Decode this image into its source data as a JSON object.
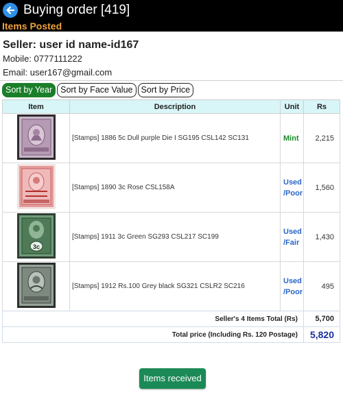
{
  "header": {
    "title": "Buying order [419]",
    "status": "Items Posted"
  },
  "seller": {
    "name": "Seller: user id name-id167",
    "mobile": "Mobile: 0777111222",
    "email": "Email: user167@gmail.com"
  },
  "sort": {
    "by_year": "Sort by Year",
    "by_face_value": "Sort by Face Value",
    "by_price": "Sort by Price",
    "active": "by_year"
  },
  "table": {
    "columns": [
      "Item",
      "Description",
      "Unit",
      "Rs"
    ],
    "rows": [
      {
        "image": "stamp-1886-dull-purple",
        "description": "[Stamps] 1886 5c Dull purple Die I SG195 CSL142 SC131",
        "unit": "Mint",
        "price": "2,215"
      },
      {
        "image": "stamp-1890-rose-overprint",
        "description": "[Stamps] 1890 3c Rose CSL158A",
        "unit": "Used /Poor",
        "price": "1,560"
      },
      {
        "image": "stamp-1911-green",
        "description": "[Stamps] 1911 3c Green SG293 CSL217 SC199",
        "unit": "Used /Fair",
        "price": "1,430"
      },
      {
        "image": "stamp-1912-grey-black",
        "description": "[Stamps] 1912 Rs.100 Grey black SG321 CSLR2 SC216",
        "unit": "Used /Poor",
        "price": "495"
      }
    ]
  },
  "totals": {
    "items_label": "Seller's 4 Items Total (Rs)",
    "items_value": "5,700",
    "total_label": "Total price (Including Rs. 120 Postage)",
    "total_value": "5,820"
  },
  "actions": {
    "received": "Items received"
  },
  "colors": {
    "header_bg": "#000000",
    "status": "#f0a23c",
    "sort_active": "#1b7f2a",
    "table_header": "#d8f5f7",
    "mint": "#1b8a2a",
    "used": "#2a66c8",
    "total_value": "#1a2fa0",
    "received_button": "#1b8a57"
  }
}
